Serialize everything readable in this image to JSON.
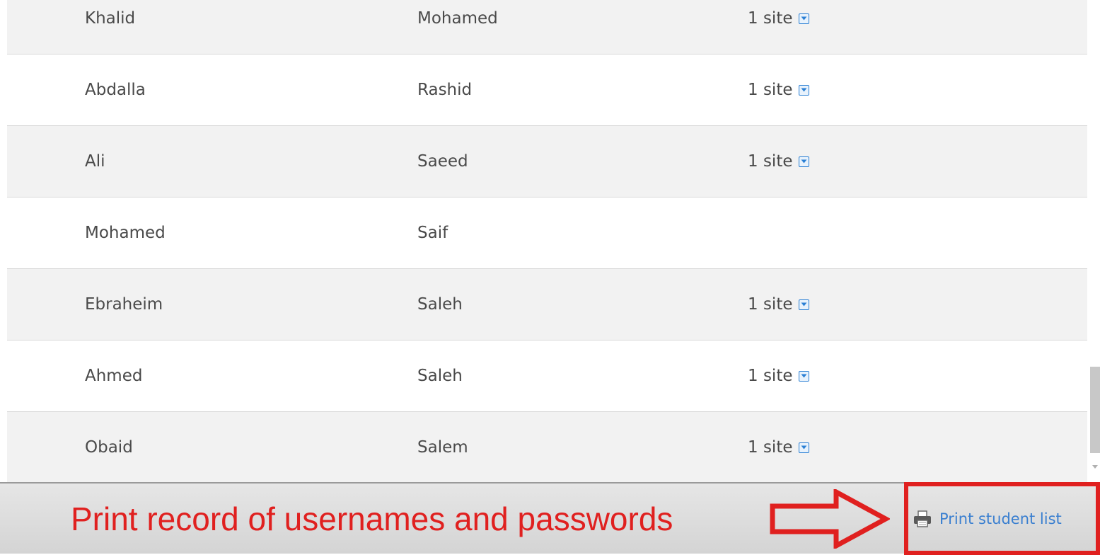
{
  "students": [
    {
      "first": "Khalid",
      "last": "Mohamed",
      "sites": "1 site",
      "has_sites": true
    },
    {
      "first": "Abdalla",
      "last": "Rashid",
      "sites": "1 site",
      "has_sites": true
    },
    {
      "first": "Ali",
      "last": "Saeed",
      "sites": "1 site",
      "has_sites": true
    },
    {
      "first": "Mohamed",
      "last": "Saif",
      "sites": "",
      "has_sites": false
    },
    {
      "first": "Ebraheim",
      "last": "Saleh",
      "sites": "1 site",
      "has_sites": true
    },
    {
      "first": "Ahmed",
      "last": "Saleh",
      "sites": "1 site",
      "has_sites": true
    },
    {
      "first": "Obaid",
      "last": "Salem",
      "sites": "1 site",
      "has_sites": true
    }
  ],
  "footer": {
    "annotation": "Print record of usernames and passwords",
    "print_label": "Print student list",
    "print_icon": "printer-icon",
    "dropdown_icon": "chevron-down-icon"
  },
  "colors": {
    "annotation_red": "#e0201f",
    "link_blue": "#3a7fd0",
    "row_alt": "#f2f2f2"
  }
}
